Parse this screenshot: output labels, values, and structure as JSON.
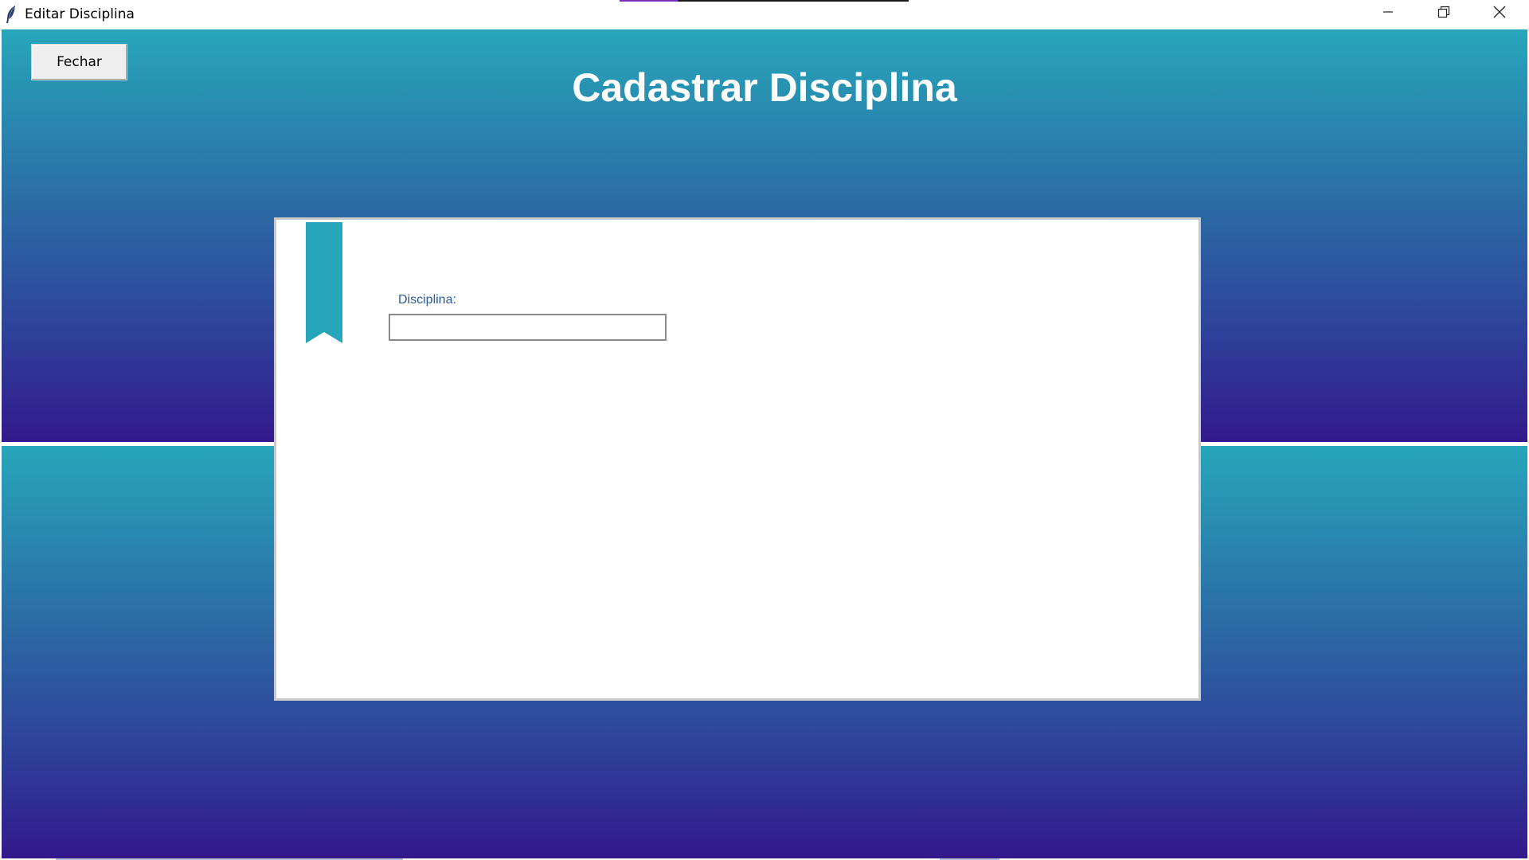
{
  "window": {
    "title": "Editar Disciplina",
    "icon": "feather-icon",
    "controls": [
      "minimize-icon",
      "restore-icon",
      "close-icon"
    ],
    "progress_fraction": 0.2
  },
  "toolbar": {
    "close_label": "Fechar"
  },
  "main": {
    "title": "Cadastrar Disciplina"
  },
  "form": {
    "bookmark_icon": "bookmark-icon",
    "discipline_label": "Disciplina:",
    "discipline_value": "",
    "discipline_placeholder": ""
  },
  "colors": {
    "gradient_top": "#27a6ba",
    "gradient_bottom": "#33198c",
    "accent": "#27a6ba",
    "label_text": "#2a5b97"
  }
}
